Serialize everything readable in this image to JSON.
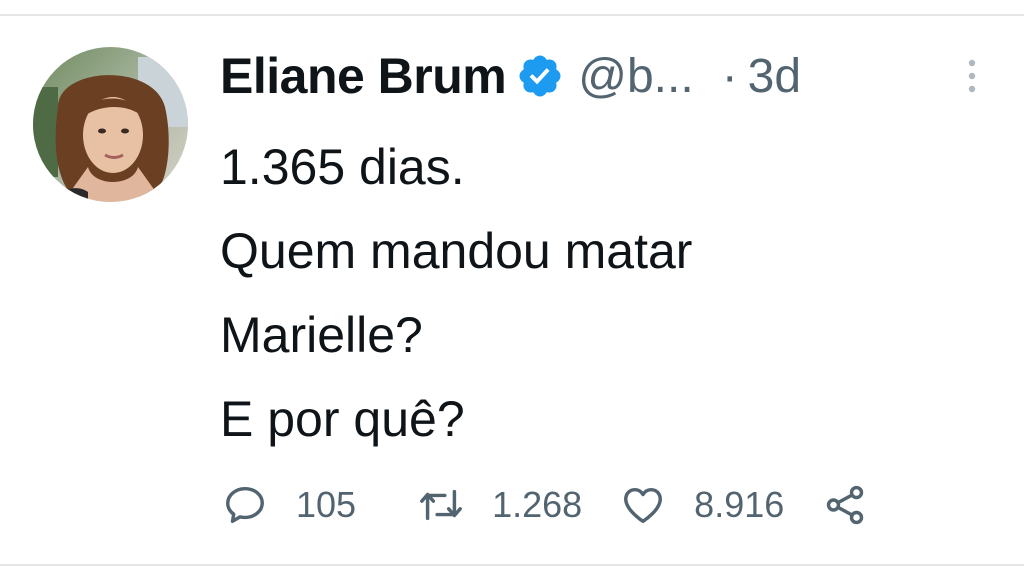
{
  "tweet": {
    "author": {
      "name": "Eliane Brum",
      "handle": "@b...",
      "verified": true,
      "avatar": "profile-photo"
    },
    "separator": "·",
    "time": "3d",
    "text_lines": [
      "1.365 dias.",
      "Quem mandou matar",
      "Marielle?",
      "E por quê?"
    ],
    "actions": {
      "reply_count": "105",
      "retweet_count": "1.268",
      "like_count": "8.916"
    }
  },
  "colors": {
    "text": "#0f1419",
    "secondary": "#536471",
    "verified": "#1d9bf0",
    "divider": "#e6e6e6"
  }
}
